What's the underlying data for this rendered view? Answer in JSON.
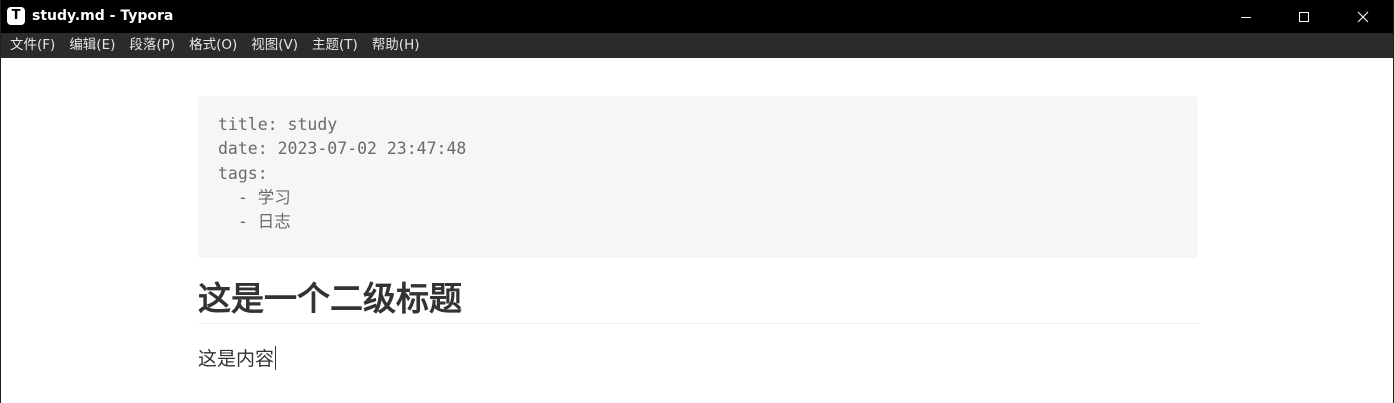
{
  "window": {
    "title": "study.md - Typora",
    "app_logo_letter": "T"
  },
  "menubar": {
    "items": [
      {
        "label": "文件(F)"
      },
      {
        "label": "编辑(E)"
      },
      {
        "label": "段落(P)"
      },
      {
        "label": "格式(O)"
      },
      {
        "label": "视图(V)"
      },
      {
        "label": "主题(T)"
      },
      {
        "label": "帮助(H)"
      }
    ]
  },
  "document": {
    "front_matter": [
      "title: study",
      "date: 2023-07-02 23:47:48",
      "tags:",
      "  - 学习",
      "  - 日志"
    ],
    "heading": "这是一个二级标题",
    "paragraph": "这是内容"
  },
  "colors": {
    "titlebar_bg": "#000000",
    "menubar_bg": "#2b2b2b",
    "frontmatter_bg": "#f6f6f6",
    "text": "#333333"
  }
}
